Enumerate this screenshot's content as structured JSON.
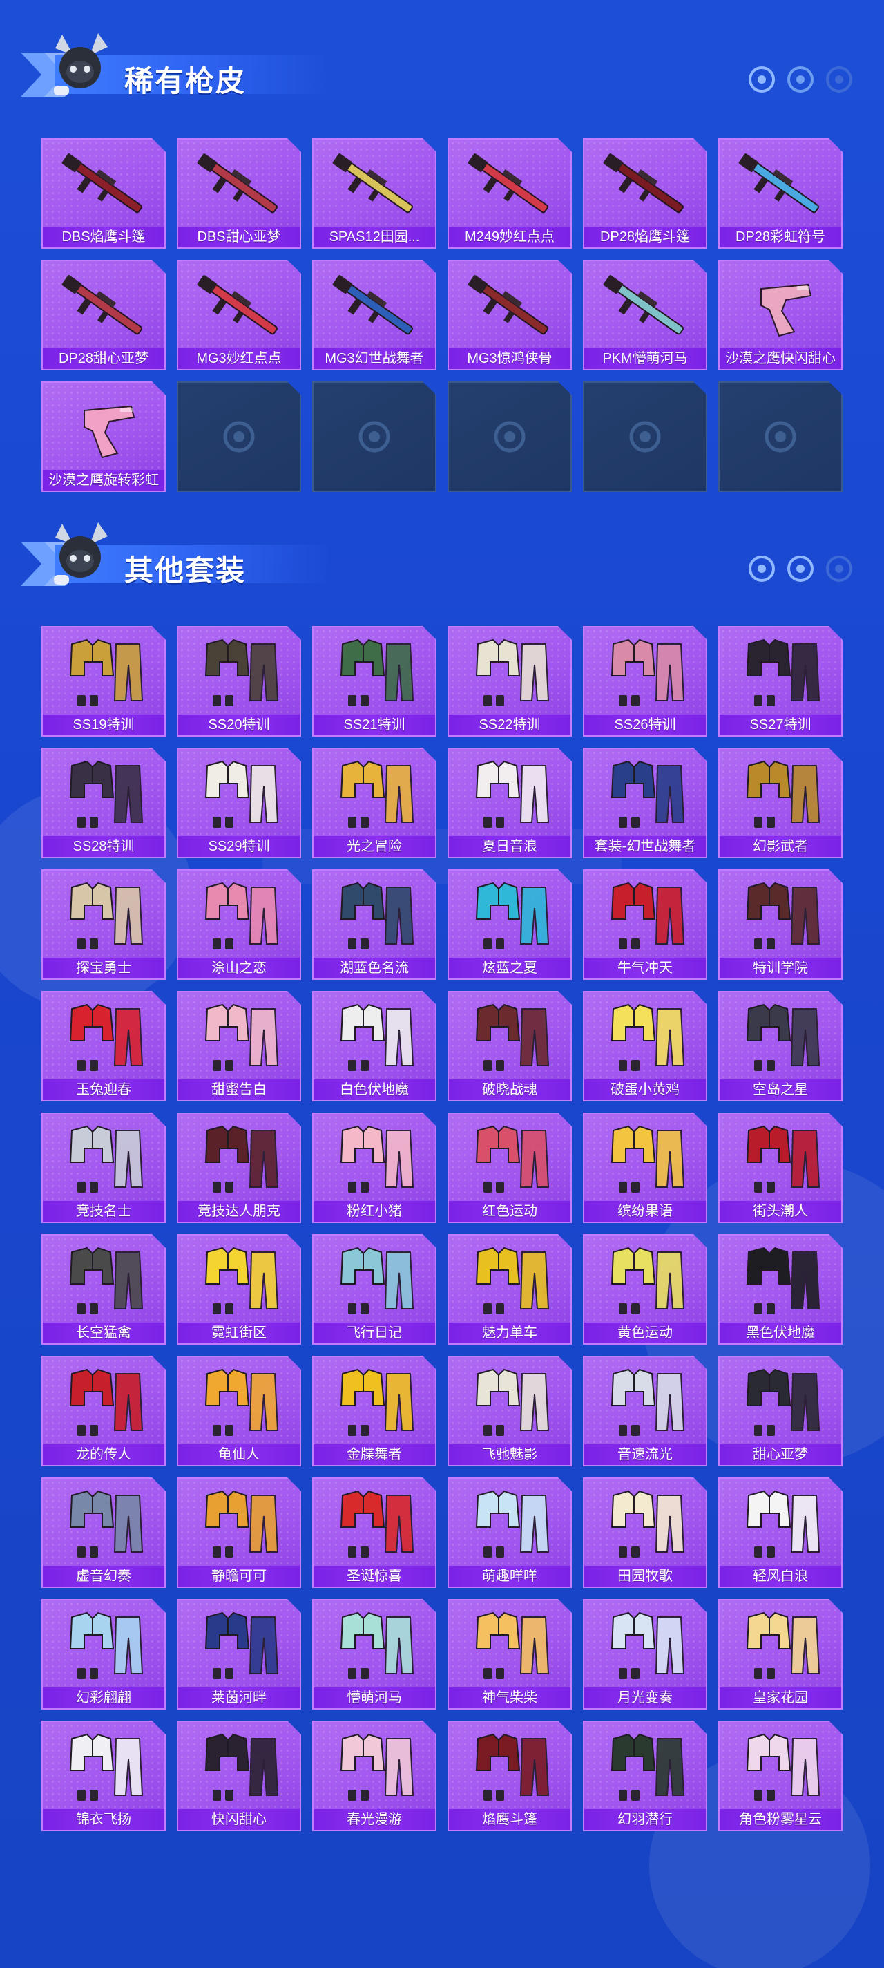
{
  "colors": {
    "background": "#1d4fd6",
    "card_purple": "#a257ef",
    "label_purple": "#7a22e6",
    "empty_slot": "#1f3764"
  },
  "sections": {
    "rare_skins": {
      "title": "稀有枪皮",
      "items": [
        {
          "label": "DBS焰鹰斗篷",
          "icon": "shotgun-icon",
          "tint": "#8c1f2a"
        },
        {
          "label": "DBS甜心亚梦",
          "icon": "shotgun-icon",
          "tint": "#b23a48"
        },
        {
          "label": "SPAS12田园...",
          "icon": "shotgun-icon",
          "tint": "#d8c25a"
        },
        {
          "label": "M249妙红点点",
          "icon": "machine-gun-icon",
          "tint": "#d23a4a"
        },
        {
          "label": "DP28焰鹰斗篷",
          "icon": "machine-gun-icon",
          "tint": "#7a1a22"
        },
        {
          "label": "DP28彩虹符号",
          "icon": "machine-gun-icon",
          "tint": "#49a9e0"
        },
        {
          "label": "DP28甜心亚梦",
          "icon": "machine-gun-icon",
          "tint": "#b23a48"
        },
        {
          "label": "MG3妙红点点",
          "icon": "machine-gun-icon",
          "tint": "#d23a4a"
        },
        {
          "label": "MG3幻世战舞者",
          "icon": "machine-gun-icon",
          "tint": "#2e5fb8"
        },
        {
          "label": "MG3惊鸿侠骨",
          "icon": "machine-gun-icon",
          "tint": "#8a2a2a"
        },
        {
          "label": "PKM懵萌河马",
          "icon": "machine-gun-icon",
          "tint": "#7fc2c8"
        },
        {
          "label": "沙漠之鹰快闪甜心",
          "icon": "pistol-icon",
          "tint": "#e9a7c2"
        },
        {
          "label": "沙漠之鹰旋转彩虹",
          "icon": "pistol-icon",
          "tint": "#f2a1c6"
        }
      ],
      "empty_slots": 5
    },
    "other_outfits": {
      "title": "其他套装",
      "items": [
        {
          "label": "SS19特训",
          "tint": "#c9a03a"
        },
        {
          "label": "SS20特训",
          "tint": "#4a4236"
        },
        {
          "label": "SS21特训",
          "tint": "#3e6d48"
        },
        {
          "label": "SS22特训",
          "tint": "#e8e2d2"
        },
        {
          "label": "SS26特训",
          "tint": "#d98aa8"
        },
        {
          "label": "SS27特训",
          "tint": "#2a2430"
        },
        {
          "label": "SS28特训",
          "tint": "#3a3046"
        },
        {
          "label": "SS29特训",
          "tint": "#f0ede4"
        },
        {
          "label": "光之冒险",
          "tint": "#e8b33a"
        },
        {
          "label": "夏日音浪",
          "tint": "#f2eef0"
        },
        {
          "label": "套装-幻世战舞者",
          "tint": "#2a3f8a"
        },
        {
          "label": "幻影武者",
          "tint": "#b88a2a"
        },
        {
          "label": "探宝勇士",
          "tint": "#d8c6a8"
        },
        {
          "label": "涂山之恋",
          "tint": "#e88ab0"
        },
        {
          "label": "湖蓝色名流",
          "tint": "#2f4a6a"
        },
        {
          "label": "炫蓝之夏",
          "tint": "#2fb8d8"
        },
        {
          "label": "牛气冲天",
          "tint": "#c8202a"
        },
        {
          "label": "特训学院",
          "tint": "#5a2a2a"
        },
        {
          "label": "玉兔迎春",
          "tint": "#d8232e"
        },
        {
          "label": "甜蜜告白",
          "tint": "#f0b8c8"
        },
        {
          "label": "白色伏地魔",
          "tint": "#eeeeee"
        },
        {
          "label": "破晓战魂",
          "tint": "#6a2a2e"
        },
        {
          "label": "破蛋小黄鸡",
          "tint": "#f4e05a"
        },
        {
          "label": "空岛之星",
          "tint": "#3a3a4a"
        },
        {
          "label": "竞技名士",
          "tint": "#c8ccd8"
        },
        {
          "label": "竞技达人朋克",
          "tint": "#5a2228"
        },
        {
          "label": "粉红小猪",
          "tint": "#f4b8c8"
        },
        {
          "label": "红色运动",
          "tint": "#d8506a"
        },
        {
          "label": "缤纷果语",
          "tint": "#f2c440"
        },
        {
          "label": "街头潮人",
          "tint": "#b81c2a"
        },
        {
          "label": "长空猛禽",
          "tint": "#4a4a4a"
        },
        {
          "label": "霓虹街区",
          "tint": "#f4d430"
        },
        {
          "label": "飞行日记",
          "tint": "#8ac8d8"
        },
        {
          "label": "魅力单车",
          "tint": "#e8c020"
        },
        {
          "label": "黄色运动",
          "tint": "#e8e060"
        },
        {
          "label": "黑色伏地魔",
          "tint": "#1e1e22"
        },
        {
          "label": "龙的传人",
          "tint": "#c8202a"
        },
        {
          "label": "龟仙人",
          "tint": "#f0a830"
        },
        {
          "label": "金牒舞者",
          "tint": "#f0c020"
        },
        {
          "label": "飞驰魅影",
          "tint": "#e8e4d8"
        },
        {
          "label": "音速流光",
          "tint": "#d8dce8"
        },
        {
          "label": "甜心亚梦",
          "tint": "#2a2a32"
        },
        {
          "label": "虚音幻奏",
          "tint": "#7888a8"
        },
        {
          "label": "静瞻可可",
          "tint": "#e8a030"
        },
        {
          "label": "圣诞惊喜",
          "tint": "#d82a2a"
        },
        {
          "label": "萌趣咩咩",
          "tint": "#c8e4f4"
        },
        {
          "label": "田园牧歌",
          "tint": "#f4ead0"
        },
        {
          "label": "轻风白浪",
          "tint": "#f4f4f4"
        },
        {
          "label": "幻彩翩翩",
          "tint": "#a8d4f0"
        },
        {
          "label": "莱茵河畔",
          "tint": "#2a3a8a"
        },
        {
          "label": "懵萌河马",
          "tint": "#a8e0d8"
        },
        {
          "label": "神气柴柴",
          "tint": "#f4c060"
        },
        {
          "label": "月光变奏",
          "tint": "#d8e4f4"
        },
        {
          "label": "皇家花园",
          "tint": "#f4d890"
        },
        {
          "label": "锦衣飞扬",
          "tint": "#f0f0f4"
        },
        {
          "label": "快闪甜心",
          "tint": "#2a2230"
        },
        {
          "label": "春光漫游",
          "tint": "#f0c8d8"
        },
        {
          "label": "焰鹰斗篷",
          "tint": "#7a1a22"
        },
        {
          "label": "幻羽潜行",
          "tint": "#2a3a2e"
        },
        {
          "label": "角色粉雾星云",
          "tint": "#f0d8ec"
        }
      ]
    }
  }
}
